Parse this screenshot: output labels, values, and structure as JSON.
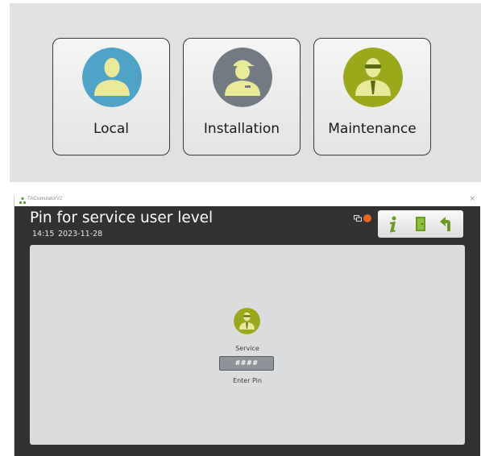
{
  "user_levels": [
    {
      "label": "Local",
      "icon": "local-user-icon",
      "color": "#4fa3c6"
    },
    {
      "label": "Installation",
      "icon": "installer-user-icon",
      "color": "#737a82"
    },
    {
      "label": "Maintenance",
      "icon": "maintenance-user-icon",
      "color": "#9aa81c"
    }
  ],
  "window": {
    "title": "TACsimulatorV2",
    "close": "×"
  },
  "screen": {
    "title": "Pin for service user level",
    "time": "14:15",
    "date": "2023-11-28"
  },
  "toolbar": {
    "buttons": [
      "info-icon",
      "exit-door-icon",
      "back-arrow-icon"
    ],
    "accent": "#6a9a1e"
  },
  "pin_dialog": {
    "user_label": "Service",
    "pin_value": "####",
    "hint": "Enter Pin"
  },
  "colors": {
    "dark_bg": "#323232",
    "panel_bg": "#dcdddf",
    "alarm": "#e8651c"
  }
}
